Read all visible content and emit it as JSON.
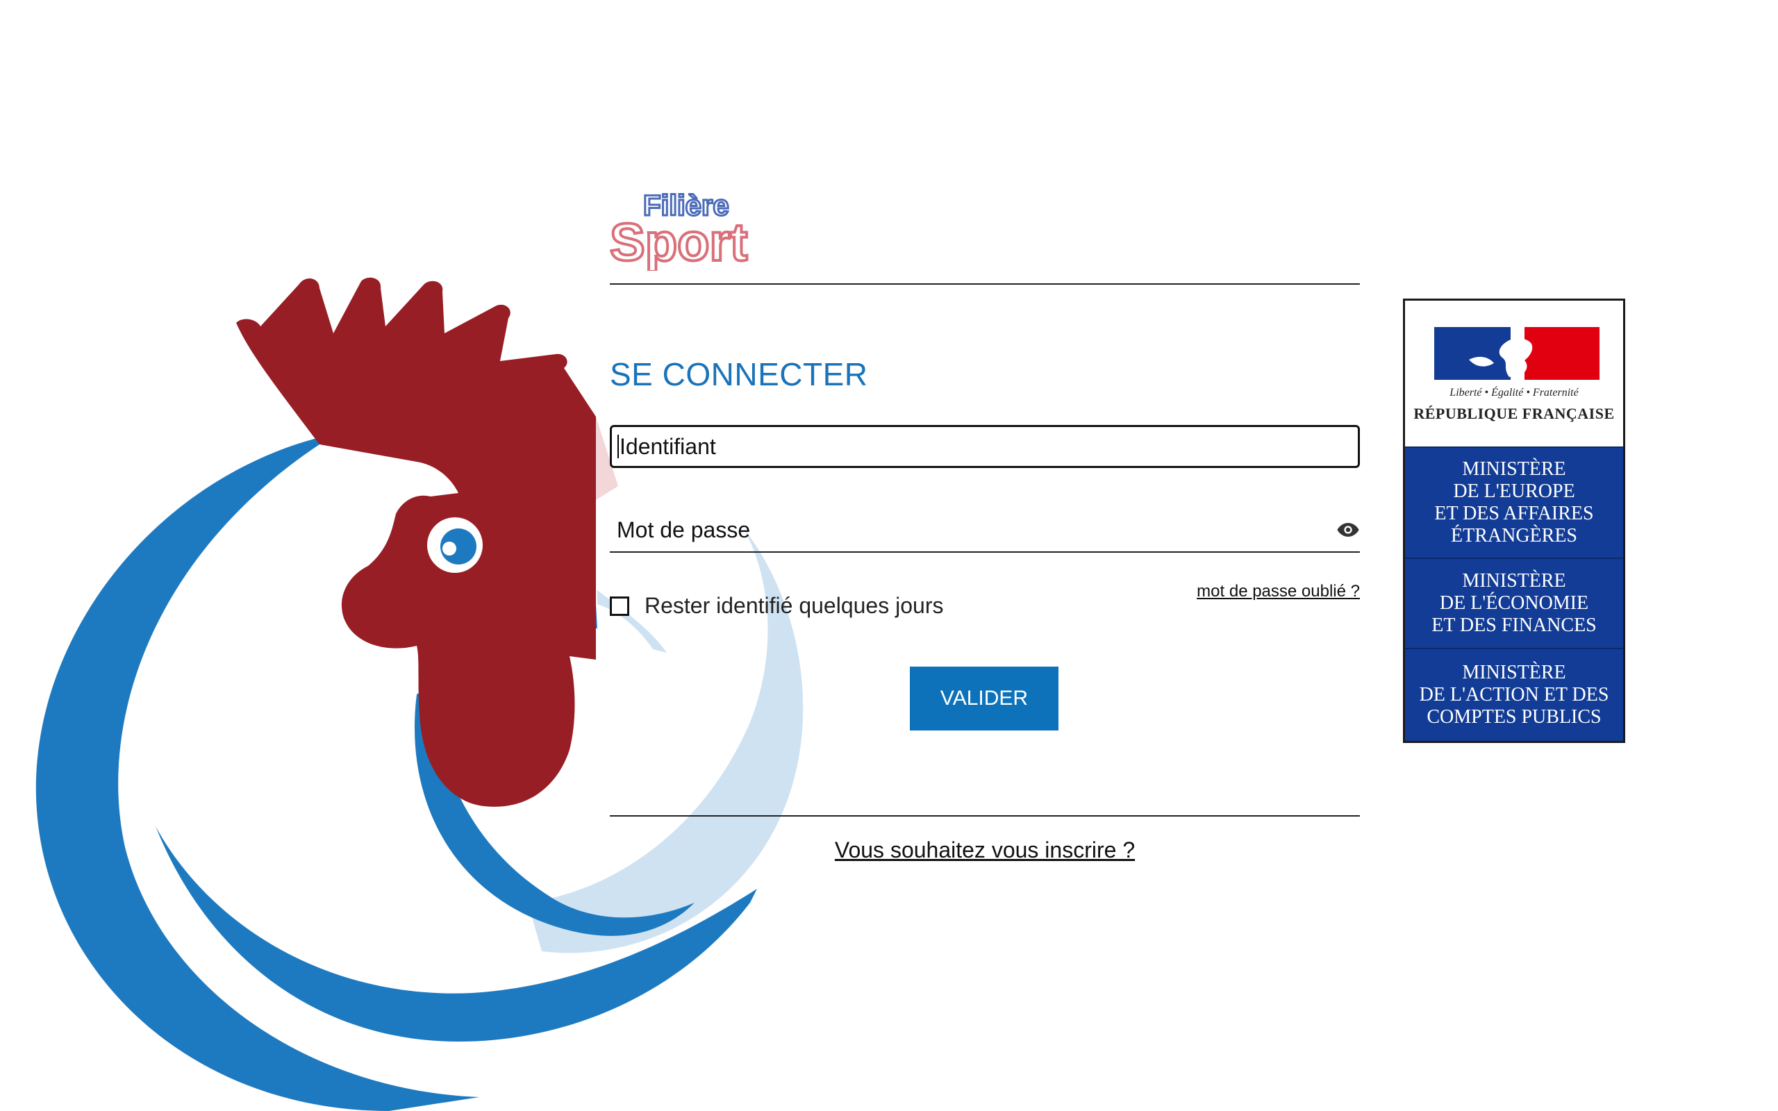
{
  "app": {
    "brand_line1": "Filière",
    "brand_line2": "Sport"
  },
  "login": {
    "title": "SE CONNECTER",
    "identifier_placeholder": "Identifiant",
    "password_placeholder": "Mot de passe",
    "forgot_password": "mot de passe oublié ?",
    "remember_me": "Rester identifié quelques jours",
    "submit": "VALIDER",
    "signup": "Vous souhaitez vous inscrire ?"
  },
  "government": {
    "motto": "Liberté • Égalité • Fraternité",
    "republic": "RÉPUBLIQUE FRANÇAISE",
    "ministries": [
      {
        "lines": [
          "MINISTÈRE",
          "DE L'EUROPE",
          "ET DES AFFAIRES",
          "ÉTRANGÈRES"
        ]
      },
      {
        "lines": [
          "MINISTÈRE",
          "DE L'ÉCONOMIE",
          "ET DES FINANCES"
        ]
      },
      {
        "lines": [
          "MINISTÈRE",
          "DE L'ACTION ET DES",
          "COMPTES PUBLICS"
        ]
      }
    ]
  },
  "colors": {
    "accent": "#0d72b9",
    "rooster_red": "#981e25",
    "rooster_blue": "#1e7ac0",
    "gov_blue": "#123c96",
    "marianne_red": "#e1000f"
  },
  "icons": {
    "password_toggle": "eye-icon"
  }
}
